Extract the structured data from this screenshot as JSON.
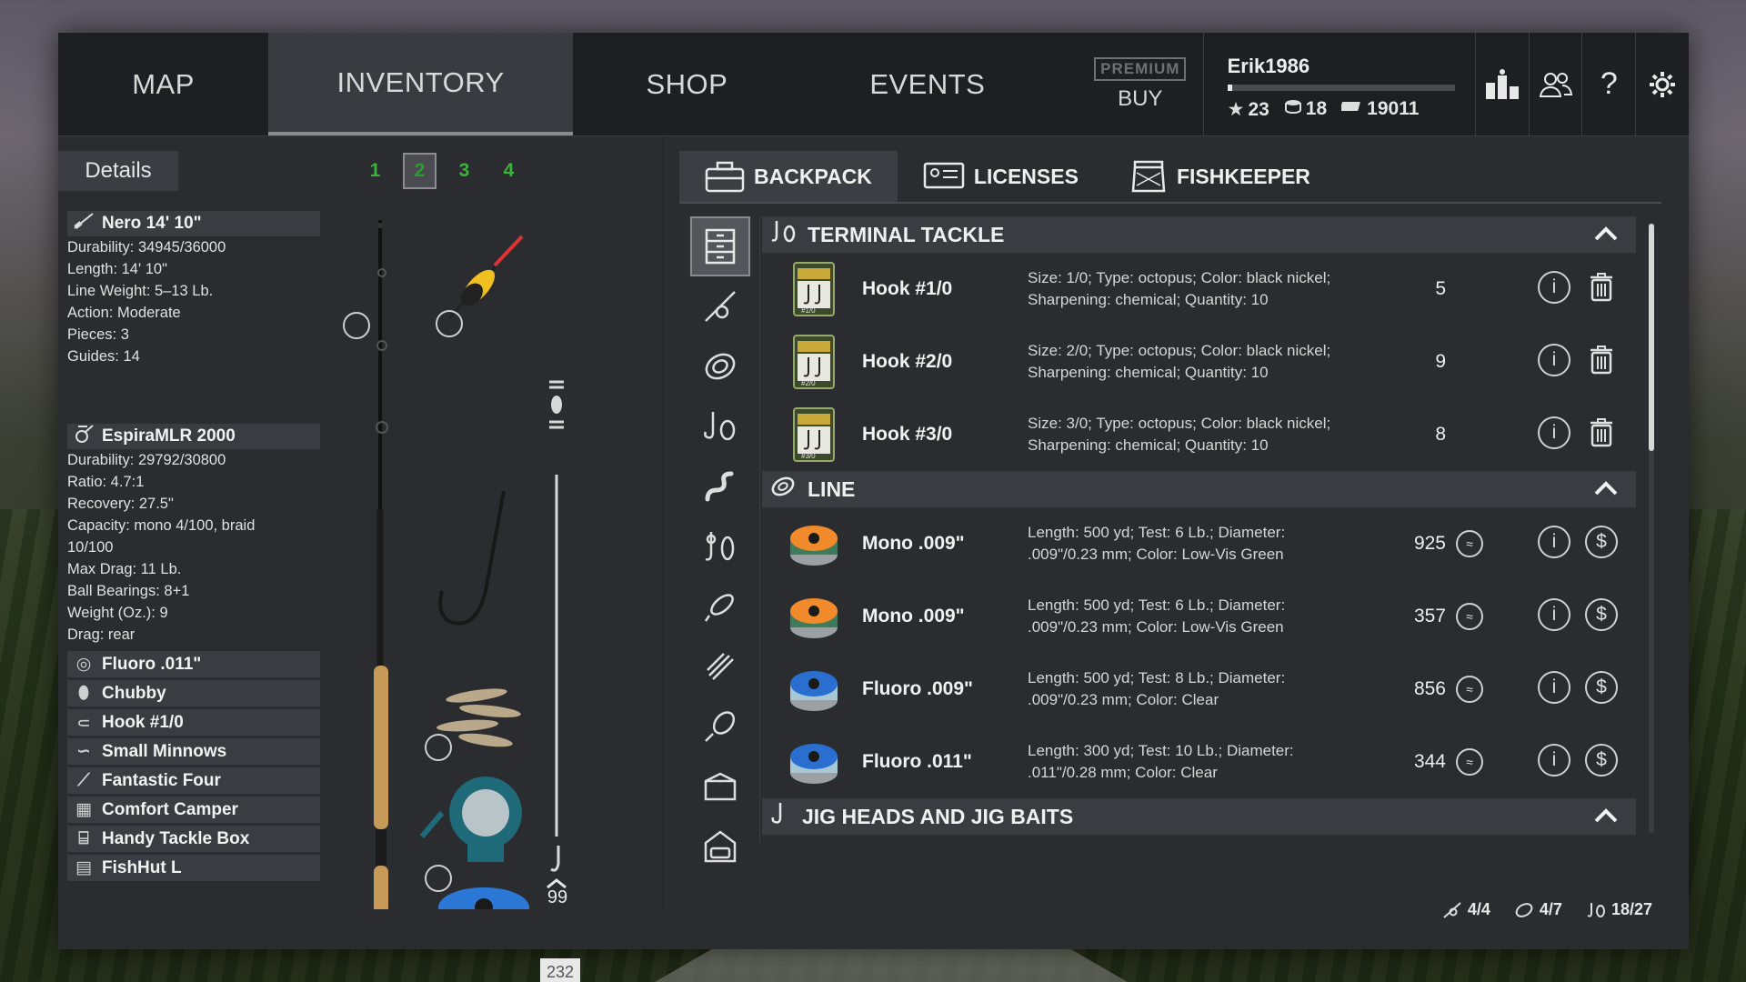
{
  "nav": {
    "tabs": [
      "MAP",
      "INVENTORY",
      "SHOP",
      "EVENTS"
    ],
    "active_tab": "INVENTORY",
    "premium_label": "PREMIUM",
    "premium_buy": "BUY"
  },
  "profile": {
    "username": "Erik1986",
    "xp_progress": 0.02,
    "level": "23",
    "coins": "18",
    "money": "19011"
  },
  "left": {
    "details_tab": "Details",
    "pages": [
      "1",
      "2",
      "3",
      "4"
    ],
    "active_page": "2",
    "rod": {
      "name": "Nero 14' 10\"",
      "lines": [
        "Durability: 34945/36000",
        "Length: 14' 10\"",
        "Line Weight: 5–13 Lb.",
        "Action: Moderate",
        "Pieces: 3",
        "Guides: 14"
      ]
    },
    "reel": {
      "name": "EspiraMLR 2000",
      "lines": [
        "Durability: 29792/30800",
        "Ratio: 4.7:1",
        "Recovery: 27.5\"",
        "Capacity: mono 4/100, braid",
        "10/100",
        "Max Drag: 11 Lb.",
        "Ball Bearings: 8+1",
        "Weight (Oz.): 9",
        "Drag: rear"
      ]
    },
    "equipment": [
      "Fluoro .011\"",
      "Chubby",
      "Hook #1/0",
      "Small Minnows",
      "Fantastic Four",
      "Comfort Camper",
      "Handy Tackle Box",
      "FishHut L"
    ],
    "line_spool_count": "232",
    "depth_value": "99"
  },
  "right": {
    "tabs": [
      "BACKPACK",
      "LICENSES",
      "FISHKEEPER"
    ],
    "active_tab": "BACKPACK",
    "groups": [
      {
        "title": "TERMINAL TACKLE",
        "items": [
          {
            "name": "Hook #1/0",
            "desc1": "Size: 1/0; Type: octopus; Color: black nickel;",
            "desc2": "Sharpening: chemical; Quantity: 10",
            "qty": "5",
            "badge": "#1/0"
          },
          {
            "name": "Hook #2/0",
            "desc1": "Size: 2/0; Type: octopus; Color: black nickel;",
            "desc2": "Sharpening: chemical; Quantity: 10",
            "qty": "9",
            "badge": "#2/0"
          },
          {
            "name": "Hook #3/0",
            "desc1": "Size: 3/0; Type: octopus; Color: black nickel;",
            "desc2": "Sharpening: chemical; Quantity: 10",
            "qty": "8",
            "badge": "#3/0"
          }
        ]
      },
      {
        "title": "LINE",
        "items": [
          {
            "name": "Mono .009\"",
            "desc1": "Length: 500 yd; Test: 6 Lb.; Diameter:",
            "desc2": ".009\"/0.23 mm; Color: Low-Vis Green",
            "qty": "925"
          },
          {
            "name": "Mono .009\"",
            "desc1": "Length: 500 yd; Test: 6 Lb.; Diameter:",
            "desc2": ".009\"/0.23 mm; Color: Low-Vis Green",
            "qty": "357"
          },
          {
            "name": "Fluoro .009\"",
            "desc1": "Length: 500 yd; Test: 8 Lb.; Diameter:",
            "desc2": ".009\"/0.23 mm; Color: Clear",
            "qty": "856"
          },
          {
            "name": "Fluoro .011\"",
            "desc1": "Length: 300 yd; Test: 10 Lb.; Diameter:",
            "desc2": ".011\"/0.28 mm; Color: Clear",
            "qty": "344"
          }
        ]
      },
      {
        "title": "JIG HEADS AND JIG BAITS",
        "items": []
      }
    ],
    "capacity": {
      "rods": "4/4",
      "lines": "4/7",
      "tackle": "18/27"
    }
  }
}
